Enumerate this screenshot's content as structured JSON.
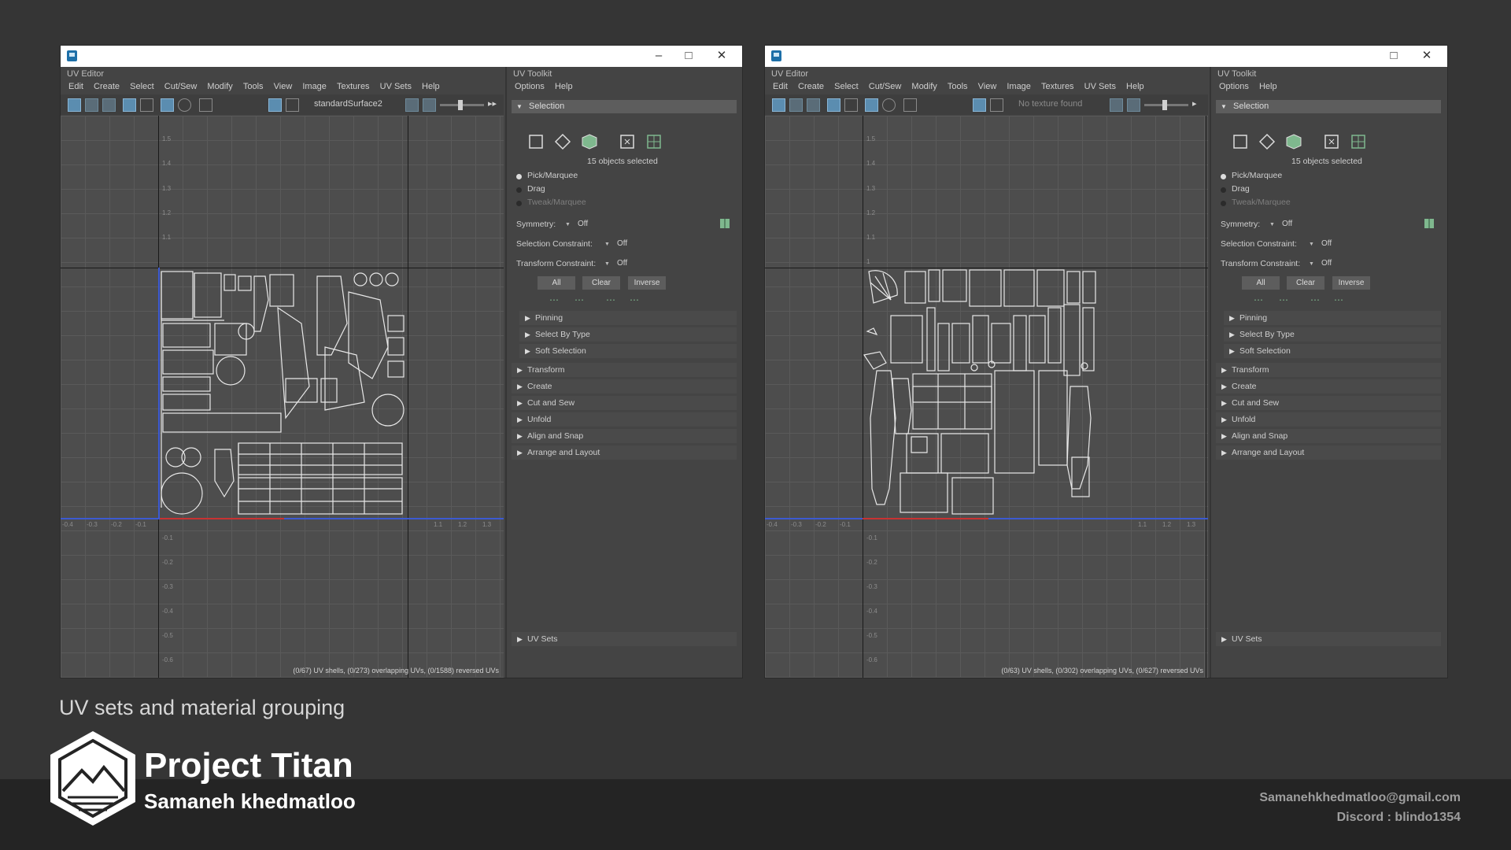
{
  "left_window": {
    "uv_editor": {
      "panel_label": "UV Editor",
      "menu": [
        "Edit",
        "Create",
        "Select",
        "Cut/Sew",
        "Modify",
        "Tools",
        "View",
        "Image",
        "Textures",
        "UV Sets",
        "Help"
      ],
      "texture_field": "standardSurface2",
      "v_ticks": [
        "1.5",
        "1.4",
        "1.3",
        "1.2",
        "1.1"
      ],
      "v_ticks_neg": [
        "-0.1",
        "-0.2",
        "-0.3",
        "-0.4",
        "-0.5",
        "-0.6"
      ],
      "u_ticks_left": [
        "-0.4",
        "-0.3",
        "-0.2",
        "-0.1"
      ],
      "u_ticks_right": [
        "1.1",
        "1.2",
        "1.3"
      ],
      "status": "(0/67) UV shells, (0/273) overlapping UVs, (0/1588) reversed UVs"
    },
    "toolkit": {
      "panel_label": "UV Toolkit",
      "options": [
        "Options",
        "Help"
      ],
      "selection_header": "Selection",
      "selected_count": "15 objects selected",
      "pick_marquee": "Pick/Marquee",
      "drag": "Drag",
      "tweak_marquee": "Tweak/Marquee",
      "symmetry_label": "Symmetry:",
      "symmetry_value": "Off",
      "selection_constraint_label": "Selection Constraint:",
      "selection_constraint_value": "Off",
      "transform_constraint_label": "Transform Constraint:",
      "transform_constraint_value": "Off",
      "btn_all": "All",
      "btn_clear": "Clear",
      "btn_inverse": "Inverse",
      "subsections": [
        "Pinning",
        "Select By Type",
        "Soft Selection"
      ],
      "sections": [
        "Transform",
        "Create",
        "Cut and Sew",
        "Unfold",
        "Align and Snap",
        "Arrange and Layout"
      ],
      "uv_sets": "UV Sets"
    }
  },
  "right_window": {
    "uv_editor": {
      "panel_label": "UV Editor",
      "menu": [
        "Edit",
        "Create",
        "Select",
        "Cut/Sew",
        "Modify",
        "Tools",
        "View",
        "Image",
        "Textures",
        "UV Sets",
        "Help"
      ],
      "texture_field": "No texture found",
      "v_ticks": [
        "1.5",
        "1.4",
        "1.3",
        "1.2",
        "1.1",
        "1"
      ],
      "v_ticks_neg": [
        "-0.1",
        "-0.2",
        "-0.3",
        "-0.4",
        "-0.5",
        "-0.6"
      ],
      "u_ticks_left": [
        "-0.4",
        "-0.3",
        "-0.2",
        "-0.1"
      ],
      "u_ticks_right": [
        "1.1",
        "1.2",
        "1.3"
      ],
      "status": "(0/63) UV shells, (0/302) overlapping UVs, (0/627) reversed UVs"
    },
    "toolkit": {
      "panel_label": "UV Toolkit",
      "options": [
        "Options",
        "Help"
      ],
      "selection_header": "Selection",
      "selected_count": "15 objects selected",
      "pick_marquee": "Pick/Marquee",
      "drag": "Drag",
      "tweak_marquee": "Tweak/Marquee",
      "symmetry_label": "Symmetry:",
      "symmetry_value": "Off",
      "selection_constraint_label": "Selection Constraint:",
      "selection_constraint_value": "Off",
      "transform_constraint_label": "Transform Constraint:",
      "transform_constraint_value": "Off",
      "btn_all": "All",
      "btn_clear": "Clear",
      "btn_inverse": "Inverse",
      "subsections": [
        "Pinning",
        "Select By Type",
        "Soft Selection"
      ],
      "sections": [
        "Transform",
        "Create",
        "Cut and Sew",
        "Unfold",
        "Align and Snap",
        "Arrange and Layout"
      ],
      "uv_sets": "UV Sets"
    }
  },
  "caption": "UV sets and material grouping",
  "brand": {
    "title": "Project Titan",
    "author": "Samaneh khedmatloo"
  },
  "contact": {
    "email": "Samanehkhedmatloo@gmail.com",
    "discord": "Discord : blindo1354"
  },
  "colors": {
    "background": "#353535",
    "band": "#242424",
    "panel": "#444444",
    "viewport": "#4d4d4d",
    "u_axis": "#c83232",
    "v_axis": "#3c5ad2"
  }
}
